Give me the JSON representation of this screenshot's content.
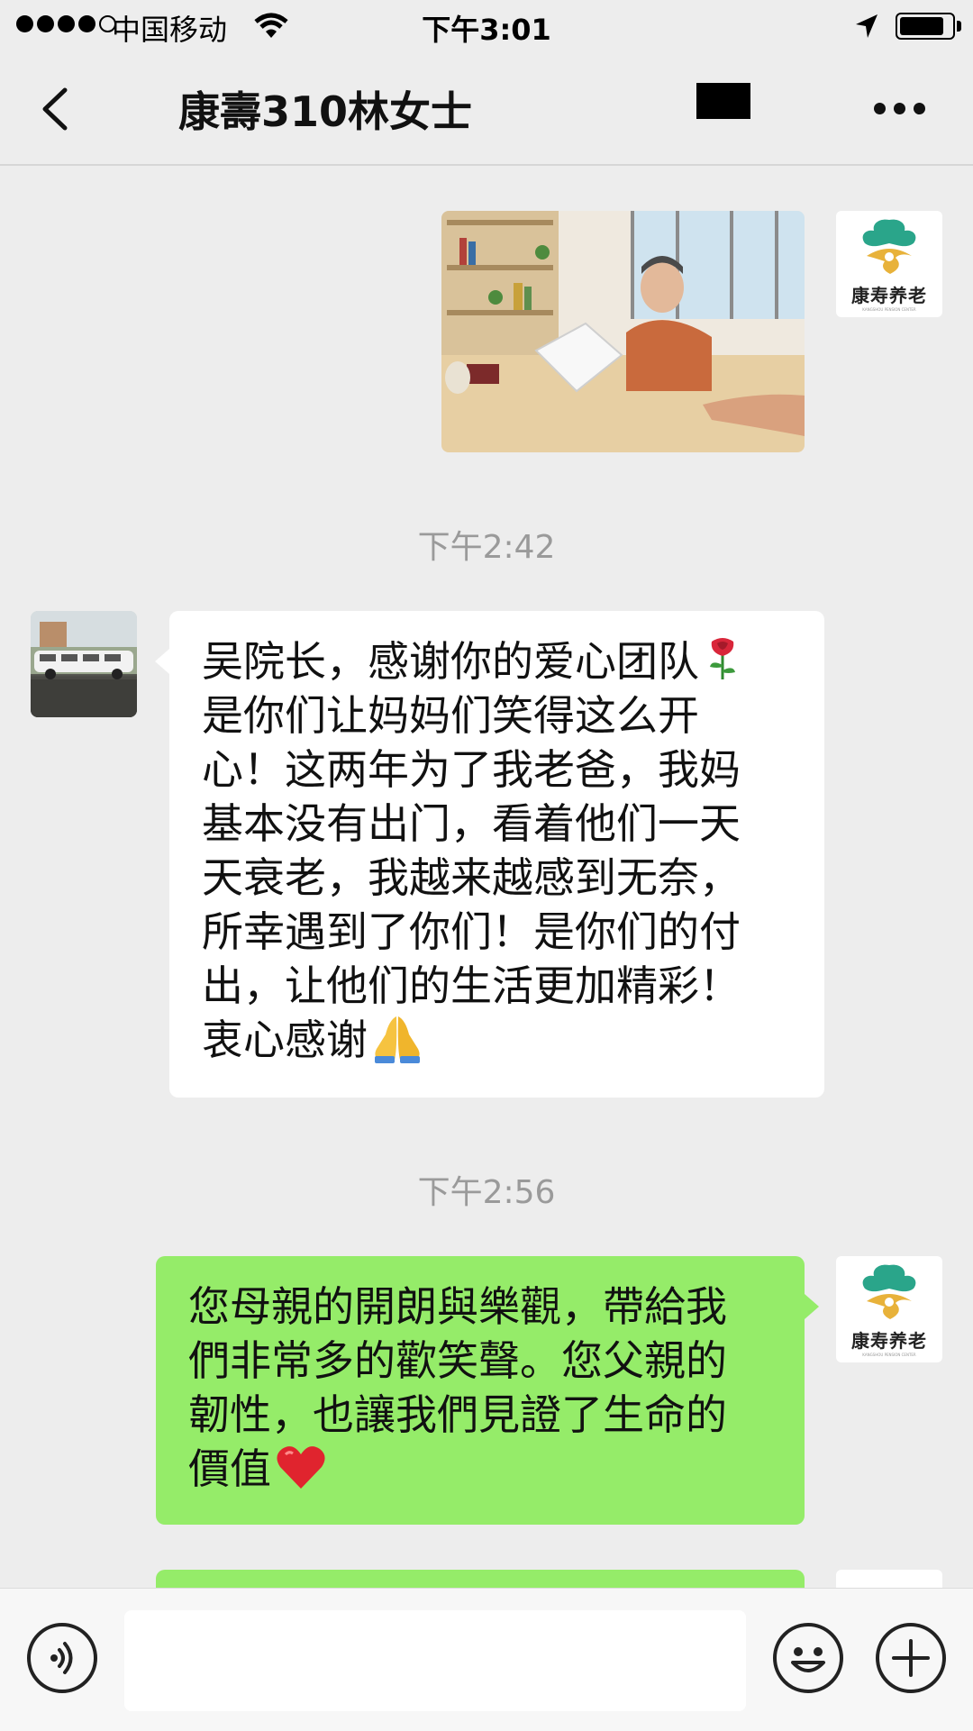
{
  "status_bar": {
    "carrier": "中国移动",
    "time": "下午3:01",
    "signal_bars_filled": 4,
    "signal_bars_total": 5,
    "battery_level": 0.85
  },
  "nav": {
    "title": "康壽310林女士",
    "back_icon": "chevron-left-icon",
    "more_icon": "more-dots-icon"
  },
  "brand_avatar": {
    "name": "康寿养老",
    "subtitle": "KANGSHOU PENSION CENTER"
  },
  "messages": {
    "timestamp_1": "下午2:42",
    "incoming": {
      "lines": [
        "吴院长，感谢你的爱心团队",
        "是你们让妈妈们笑得这么开",
        "心！这两年为了我老爸，我妈",
        "基本没有出门，看着他们一天",
        "天衰老，我越来越感到无奈，",
        "所幸遇到了你们！是你们的付",
        "出，让他们的生活更加精彩！",
        "衷心感谢"
      ],
      "emojis": [
        "rose",
        "folded-hands"
      ]
    },
    "timestamp_2": "下午2:56",
    "outgoing": {
      "lines": [
        "您母親的開朗與樂觀，帶給我",
        "們非常多的歡笑聲。您父親的",
        "韌性，也讓我們見證了生命的",
        "價值"
      ],
      "emojis": [
        "red-heart"
      ]
    }
  },
  "input_bar": {
    "voice_icon": "voice-icon",
    "emoji_icon": "smiley-icon",
    "plus_icon": "plus-icon",
    "input_value": ""
  },
  "colors": {
    "background": "#ededed",
    "outgoing_bubble": "#95ec69",
    "incoming_bubble": "#ffffff",
    "timestamp": "#9a9a9a",
    "brand_green": "#2aa58a",
    "brand_gold": "#e8b23a"
  }
}
